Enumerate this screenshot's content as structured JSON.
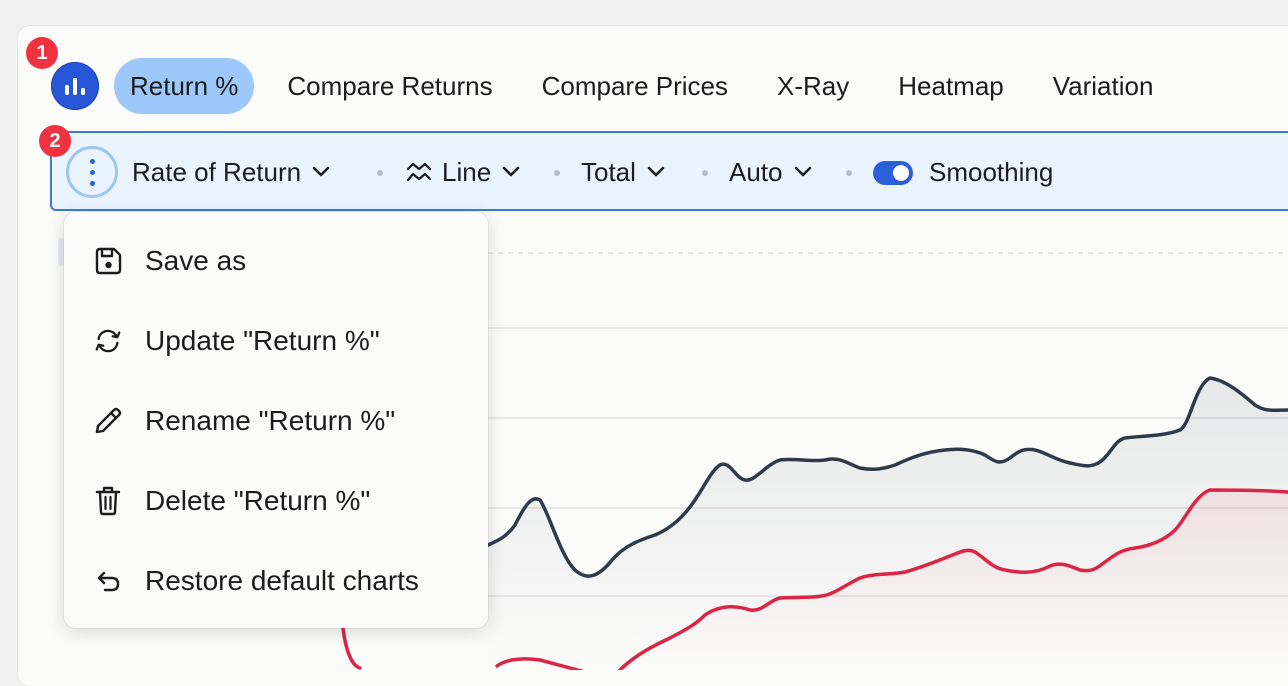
{
  "badges": [
    "1",
    "2"
  ],
  "tabs": [
    {
      "label": "Return %",
      "active": true
    },
    {
      "label": "Compare Returns"
    },
    {
      "label": "Compare Prices"
    },
    {
      "label": "X-Ray"
    },
    {
      "label": "Heatmap"
    },
    {
      "label": "Variation"
    }
  ],
  "toolbar": {
    "metric": "Rate of Return",
    "chart_type": "Line",
    "aggregation": "Total",
    "scale": "Auto",
    "smoothing_label": "Smoothing",
    "smoothing_on": true
  },
  "menu": {
    "items": [
      {
        "label": "Save as",
        "icon": "save-icon"
      },
      {
        "label": "Update \"Return %\"",
        "icon": "refresh-icon"
      },
      {
        "label": "Rename \"Return %\"",
        "icon": "pencil-icon"
      },
      {
        "label": "Delete \"Return %\"",
        "icon": "trash-icon"
      },
      {
        "label": "Restore default charts",
        "icon": "undo-icon"
      }
    ]
  },
  "colors": {
    "accent": "#2756d6",
    "active_tab": "#9cc8fb",
    "series_dark": "#2f3a4a",
    "series_red": "#dc2546",
    "badge": "#f0313f"
  }
}
